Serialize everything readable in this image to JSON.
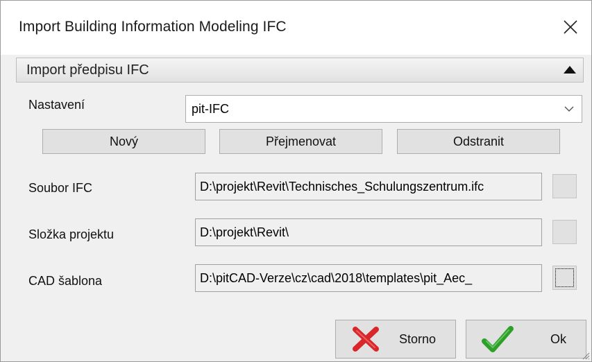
{
  "window": {
    "title": "Import Building Information Modeling IFC"
  },
  "section": {
    "title": "Import předpisu IFC"
  },
  "settings": {
    "label": "Nastavení",
    "selected": "pit-IFC"
  },
  "buttons": {
    "new": "Nový",
    "rename": "Přejmenovat",
    "delete": "Odstranit"
  },
  "fields": {
    "ifc_file": {
      "label": "Soubor IFC",
      "value": "D:\\projekt\\Revit\\Technisches_Schulungszentrum.ifc"
    },
    "project_folder": {
      "label": "Složka projektu",
      "value": "D:\\projekt\\Revit\\"
    },
    "cad_template": {
      "label": "CAD šablona",
      "value": "D:\\pitCAD-Verze\\cz\\cad\\2018\\templates\\pit_Aec_"
    }
  },
  "actions": {
    "cancel": "Storno",
    "ok": "Ok"
  },
  "colors": {
    "cancel_icon": "#d8262b",
    "ok_icon": "#2ea02a"
  },
  "icons": {
    "close": "close-icon",
    "collapse": "triangle-up-icon",
    "dropdown": "chevron-down-icon",
    "cancel": "red-x-icon",
    "ok": "green-check-icon",
    "resize": "resize-grip-icon"
  }
}
